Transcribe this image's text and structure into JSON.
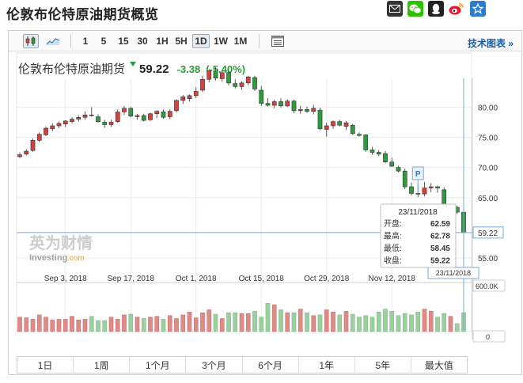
{
  "page": {
    "title": "伦敦布伦特原油期货概览"
  },
  "share_icons": [
    {
      "name": "email-icon",
      "color": "#333333"
    },
    {
      "name": "wechat-icon",
      "color": "#2dc100"
    },
    {
      "name": "qq-icon",
      "color": "#222222"
    },
    {
      "name": "weibo-icon",
      "color": "#e6162d"
    },
    {
      "name": "favorite-star-icon",
      "color": "#2b7bd1"
    }
  ],
  "toolbar": {
    "chart_type_icons": [
      "candlestick-icon",
      "area-chart-icon"
    ],
    "intervals": [
      "1",
      "5",
      "15",
      "30",
      "1H",
      "5H",
      "1D",
      "1W",
      "1M"
    ],
    "active_interval": "1D",
    "settings_icon": "chart-settings-icon",
    "tech_link": "技术图表 »"
  },
  "quote": {
    "name": "伦敦布伦特原油期货",
    "price": "59.22",
    "change": "-3.38",
    "change_pct": "(-5.40%)",
    "down_color": "#2a9d3a"
  },
  "tooltip": {
    "date": "23/11/2018",
    "rows": [
      {
        "label": "开盘:",
        "value": "62.59"
      },
      {
        "label": "最高:",
        "value": "62.78"
      },
      {
        "label": "最低:",
        "value": "58.45"
      },
      {
        "label": "收盘:",
        "value": "59.22"
      }
    ]
  },
  "marker": {
    "label": "P"
  },
  "watermark": {
    "cn": "英为财情",
    "en": "Investing",
    "suffix": ".com"
  },
  "crosshair": {
    "price_label": "59.22",
    "date_label": "23/11/2018"
  },
  "volume_axis": {
    "max_label": "600.0K",
    "zero_label": "0"
  },
  "range_buttons": [
    "1日",
    "1周",
    "1个月",
    "3个月",
    "6个月",
    "1年",
    "5年",
    "最大值"
  ],
  "chart_data": {
    "type": "candlestick",
    "title": "伦敦布伦特原油期货",
    "y_ticks": [
      "80.00",
      "75.00",
      "70.00",
      "65.00",
      "55.00"
    ],
    "y_tick_values": [
      80,
      75,
      70,
      65,
      55
    ],
    "ylim": [
      53.3,
      84.5
    ],
    "x_ticks": [
      "Sep 3, 2018",
      "Sep 17, 2018",
      "Oct 1, 2018",
      "Oct 15, 2018",
      "Oct 29, 2018",
      "Nov 12, 2018"
    ],
    "x_tick_index": [
      7,
      17,
      27,
      37,
      47,
      57
    ],
    "up_color": "#d0433f",
    "down_color": "#2e9b3e",
    "candles": [
      {
        "o": 71.8,
        "h": 72.5,
        "l": 71.5,
        "c": 72.1
      },
      {
        "o": 72.2,
        "h": 73.0,
        "l": 72.0,
        "c": 72.7
      },
      {
        "o": 72.8,
        "h": 74.8,
        "l": 72.6,
        "c": 74.5
      },
      {
        "o": 74.5,
        "h": 75.8,
        "l": 74.2,
        "c": 75.5
      },
      {
        "o": 75.4,
        "h": 76.8,
        "l": 75.2,
        "c": 76.5
      },
      {
        "o": 76.4,
        "h": 77.3,
        "l": 76.0,
        "c": 76.9
      },
      {
        "o": 76.9,
        "h": 77.6,
        "l": 76.5,
        "c": 77.3
      },
      {
        "o": 77.2,
        "h": 77.8,
        "l": 76.7,
        "c": 77.7
      },
      {
        "o": 77.6,
        "h": 78.3,
        "l": 77.3,
        "c": 78.0
      },
      {
        "o": 78.0,
        "h": 78.6,
        "l": 77.6,
        "c": 78.3
      },
      {
        "o": 78.3,
        "h": 79.3,
        "l": 77.9,
        "c": 78.7
      },
      {
        "o": 78.7,
        "h": 80.0,
        "l": 78.4,
        "c": 78.6
      },
      {
        "o": 78.4,
        "h": 78.8,
        "l": 77.4,
        "c": 77.6
      },
      {
        "o": 77.5,
        "h": 77.9,
        "l": 76.6,
        "c": 77.1
      },
      {
        "o": 77.1,
        "h": 77.9,
        "l": 76.7,
        "c": 77.5
      },
      {
        "o": 77.6,
        "h": 79.6,
        "l": 77.4,
        "c": 79.2
      },
      {
        "o": 79.2,
        "h": 80.2,
        "l": 78.7,
        "c": 79.8
      },
      {
        "o": 79.8,
        "h": 80.0,
        "l": 78.3,
        "c": 78.5
      },
      {
        "o": 78.4,
        "h": 78.9,
        "l": 77.9,
        "c": 78.6
      },
      {
        "o": 78.6,
        "h": 78.9,
        "l": 77.6,
        "c": 77.8
      },
      {
        "o": 77.9,
        "h": 79.1,
        "l": 77.7,
        "c": 78.9
      },
      {
        "o": 78.9,
        "h": 79.5,
        "l": 78.2,
        "c": 79.3
      },
      {
        "o": 79.2,
        "h": 79.6,
        "l": 78.1,
        "c": 78.3
      },
      {
        "o": 78.4,
        "h": 79.6,
        "l": 78.0,
        "c": 79.3
      },
      {
        "o": 79.4,
        "h": 81.3,
        "l": 79.1,
        "c": 81.1
      },
      {
        "o": 81.1,
        "h": 82.0,
        "l": 80.5,
        "c": 81.7
      },
      {
        "o": 81.4,
        "h": 82.1,
        "l": 80.9,
        "c": 81.9
      },
      {
        "o": 81.9,
        "h": 83.3,
        "l": 81.5,
        "c": 82.6
      },
      {
        "o": 82.8,
        "h": 85.2,
        "l": 82.5,
        "c": 84.6
      },
      {
        "o": 84.6,
        "h": 86.3,
        "l": 84.1,
        "c": 86.0
      },
      {
        "o": 86.0,
        "h": 86.6,
        "l": 84.4,
        "c": 84.8
      },
      {
        "o": 84.7,
        "h": 86.0,
        "l": 84.2,
        "c": 85.7
      },
      {
        "o": 85.7,
        "h": 86.1,
        "l": 83.6,
        "c": 84.0
      },
      {
        "o": 83.9,
        "h": 84.6,
        "l": 83.1,
        "c": 83.4
      },
      {
        "o": 83.4,
        "h": 84.3,
        "l": 82.9,
        "c": 84.0
      },
      {
        "o": 84.0,
        "h": 85.2,
        "l": 83.6,
        "c": 85.0
      },
      {
        "o": 84.9,
        "h": 85.2,
        "l": 82.7,
        "c": 83.0
      },
      {
        "o": 82.8,
        "h": 83.5,
        "l": 80.2,
        "c": 80.6
      },
      {
        "o": 80.6,
        "h": 81.5,
        "l": 80.1,
        "c": 80.3
      },
      {
        "o": 80.3,
        "h": 81.2,
        "l": 79.8,
        "c": 80.9
      },
      {
        "o": 80.9,
        "h": 81.5,
        "l": 79.9,
        "c": 80.2
      },
      {
        "o": 80.2,
        "h": 81.3,
        "l": 80.0,
        "c": 81.0
      },
      {
        "o": 81.0,
        "h": 81.2,
        "l": 79.0,
        "c": 79.4
      },
      {
        "o": 79.4,
        "h": 80.2,
        "l": 78.9,
        "c": 79.6
      },
      {
        "o": 79.6,
        "h": 80.1,
        "l": 79.0,
        "c": 79.3
      },
      {
        "o": 79.3,
        "h": 80.4,
        "l": 78.8,
        "c": 79.8
      },
      {
        "o": 79.5,
        "h": 79.9,
        "l": 76.2,
        "c": 76.4
      },
      {
        "o": 76.3,
        "h": 77.4,
        "l": 75.1,
        "c": 76.9
      },
      {
        "o": 76.9,
        "h": 77.8,
        "l": 76.4,
        "c": 77.6
      },
      {
        "o": 77.6,
        "h": 77.9,
        "l": 76.8,
        "c": 77.0
      },
      {
        "o": 76.8,
        "h": 77.7,
        "l": 76.2,
        "c": 77.4
      },
      {
        "o": 77.0,
        "h": 77.2,
        "l": 75.4,
        "c": 75.6
      },
      {
        "o": 75.5,
        "h": 75.8,
        "l": 75.1,
        "c": 75.3
      },
      {
        "o": 75.4,
        "h": 75.5,
        "l": 72.6,
        "c": 72.9
      },
      {
        "o": 72.9,
        "h": 73.4,
        "l": 72.1,
        "c": 72.5
      },
      {
        "o": 72.5,
        "h": 72.9,
        "l": 71.9,
        "c": 72.2
      },
      {
        "o": 72.3,
        "h": 72.7,
        "l": 70.7,
        "c": 70.9
      },
      {
        "o": 70.9,
        "h": 71.6,
        "l": 70.1,
        "c": 70.2
      },
      {
        "o": 70.0,
        "h": 70.3,
        "l": 69.2,
        "c": 69.4
      },
      {
        "o": 69.4,
        "h": 69.8,
        "l": 66.4,
        "c": 66.8
      },
      {
        "o": 66.8,
        "h": 67.5,
        "l": 65.4,
        "c": 65.7
      },
      {
        "o": 65.7,
        "h": 67.4,
        "l": 65.1,
        "c": 65.6
      },
      {
        "o": 65.6,
        "h": 67.6,
        "l": 65.2,
        "c": 66.6
      },
      {
        "o": 66.6,
        "h": 67.4,
        "l": 65.9,
        "c": 66.8
      },
      {
        "o": 66.8,
        "h": 67.0,
        "l": 65.8,
        "c": 66.6
      },
      {
        "o": 66.3,
        "h": 66.7,
        "l": 62.1,
        "c": 62.6
      },
      {
        "o": 62.6,
        "h": 63.6,
        "l": 62.2,
        "c": 63.4
      },
      {
        "o": 63.4,
        "h": 63.7,
        "l": 62.3,
        "c": 62.6
      },
      {
        "o": 62.59,
        "h": 62.78,
        "l": 58.45,
        "c": 59.22
      }
    ],
    "volume_max": 600,
    "volume_unit": "K",
    "volumes": [
      200,
      190,
      170,
      230,
      200,
      160,
      170,
      170,
      210,
      160,
      170,
      210,
      150,
      150,
      200,
      170,
      230,
      240,
      200,
      180,
      200,
      210,
      170,
      220,
      180,
      230,
      270,
      190,
      260,
      300,
      240,
      180,
      260,
      260,
      250,
      250,
      280,
      200,
      390,
      370,
      300,
      260,
      260,
      310,
      260,
      220,
      230,
      300,
      270,
      230,
      280,
      240,
      200,
      220,
      200,
      270,
      310,
      280,
      220,
      250,
      230,
      270,
      310,
      280,
      200,
      250,
      210,
      110,
      260
    ]
  }
}
